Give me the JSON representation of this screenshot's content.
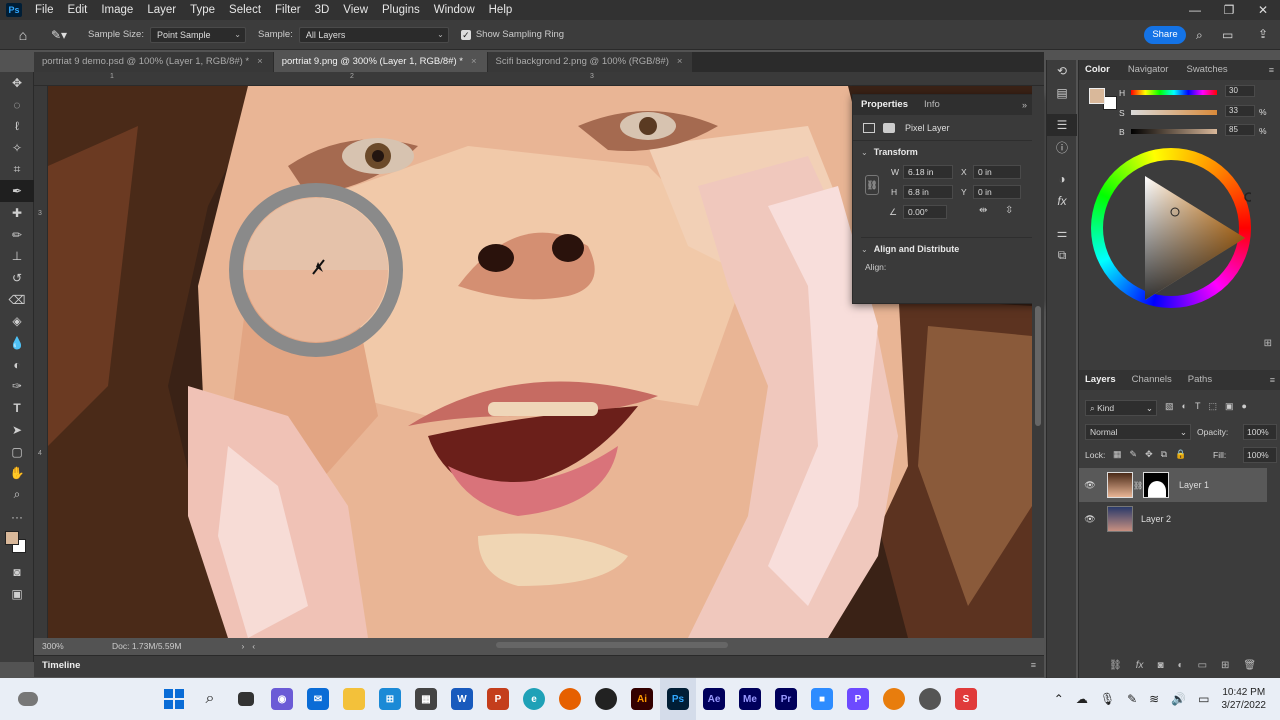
{
  "menubar": {
    "logo": "Ps",
    "items": [
      "File",
      "Edit",
      "Image",
      "Layer",
      "Type",
      "Select",
      "Filter",
      "3D",
      "View",
      "Plugins",
      "Window",
      "Help"
    ]
  },
  "options": {
    "sample_size_label": "Sample Size:",
    "sample_size_value": "Point Sample",
    "sample_label": "Sample:",
    "sample_value": "All Layers",
    "sampling_ring_label": "Show Sampling Ring",
    "share_label": "Share"
  },
  "tabs": [
    {
      "label": "portriat 9 demo.psd @ 100% (Layer 1, RGB/8#) *"
    },
    {
      "label": "portriat 9.png @ 300% (Layer 1, RGB/8#) *"
    },
    {
      "label": "Scifi backgrond 2.png @ 100% (RGB/8#)"
    }
  ],
  "ruler": {
    "h_marks": [
      "1",
      "2",
      "3"
    ],
    "v_marks": [
      "3",
      "4"
    ]
  },
  "status": {
    "zoom": "300%",
    "doc": "Doc: 1.73M/5.59M"
  },
  "timeline": {
    "label": "Timeline"
  },
  "properties": {
    "tab_active": "Properties",
    "tab_other": "Info",
    "layer_type": "Pixel Layer",
    "transform_label": "Transform",
    "w_label": "W",
    "w_value": "6.18 in",
    "h_label": "H",
    "h_value": "6.8 in",
    "x_label": "X",
    "x_value": "0 in",
    "y_label": "Y",
    "y_value": "0 in",
    "angle_value": "0.00°",
    "align_label": "Align and Distribute",
    "align_sub": "Align:"
  },
  "color_panel": {
    "tabs": [
      "Color",
      "Navigator",
      "Swatches"
    ],
    "h_label": "H",
    "h_value": "30",
    "s_label": "S",
    "s_value": "33",
    "b_label": "B",
    "b_value": "85",
    "pct": "%",
    "fg_color": "#d9b89a",
    "bg_color": "#ffffff"
  },
  "layers_panel": {
    "tabs": [
      "Layers",
      "Channels",
      "Paths"
    ],
    "kind_label": "Kind",
    "blend_mode": "Normal",
    "opacity_label": "Opacity:",
    "opacity_value": "100%",
    "lock_label": "Lock:",
    "fill_label": "Fill:",
    "fill_value": "100%",
    "layers": [
      {
        "name": "Layer 1"
      },
      {
        "name": "Layer 2"
      }
    ]
  },
  "taskbar": {
    "time": "10:42 PM",
    "date": "3/27/2022",
    "apps": [
      "Ai",
      "Ps",
      "Ae",
      "Me",
      "Pr"
    ]
  },
  "accent": "#1473e6"
}
